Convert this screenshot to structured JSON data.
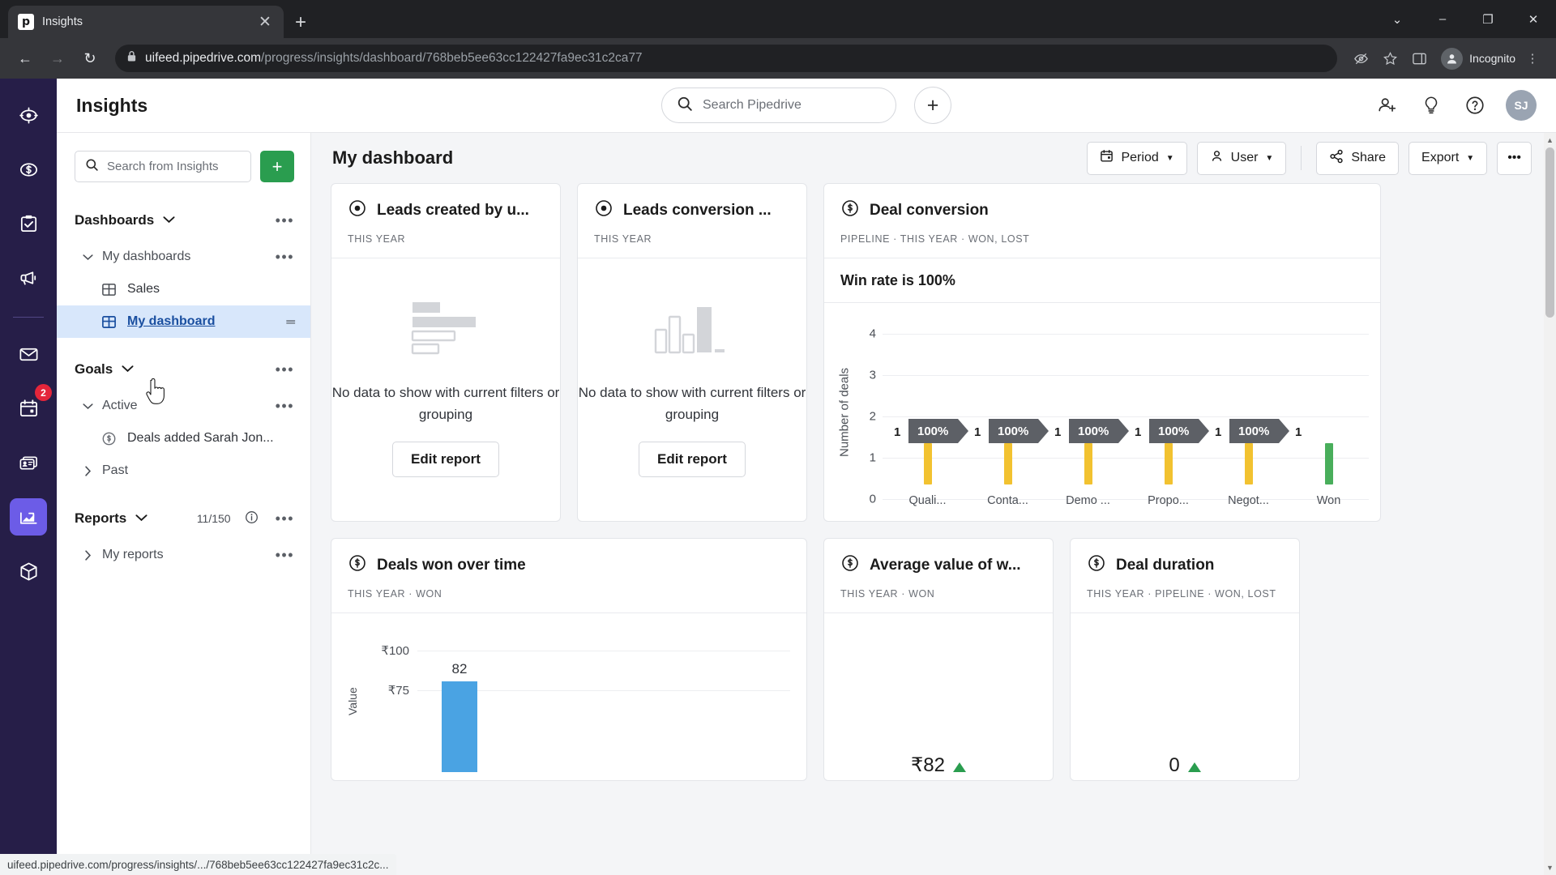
{
  "browser": {
    "tab": {
      "title": "Insights",
      "favicon_letter": "p",
      "close_icon": "close-icon"
    },
    "new_tab_label": "+",
    "window": {
      "minimize": "–",
      "maximize": "❐",
      "close": "✕",
      "chevron_down": "⌄"
    },
    "nav": {
      "back": "←",
      "forward": "→",
      "reload": "↻"
    },
    "url": {
      "lock_icon": "lock-icon",
      "domain": "uifeed.pipedrive.com",
      "path": "/progress/insights/dashboard/768beb5ee63cc122427fa9ec31c2ca77"
    },
    "omni_icons": {
      "block_third_party": "eye-slash-icon",
      "bookmark": "star-icon",
      "side_panel": "side-panel-icon",
      "menu": "kebab-menu-icon"
    },
    "incognito_label": "Incognito",
    "status_bar": "uifeed.pipedrive.com/progress/insights/.../768beb5ee63cc122427fa9ec31c2c..."
  },
  "rail": {
    "items": [
      {
        "name": "leads",
        "icon": "target-icon",
        "active": false,
        "badge": ""
      },
      {
        "name": "deals",
        "icon": "dollar-circle-icon",
        "active": false,
        "badge": ""
      },
      {
        "name": "activities",
        "icon": "clipboard-check-icon",
        "active": false,
        "badge": ""
      },
      {
        "name": "campaigns",
        "icon": "megaphone-icon",
        "active": false,
        "badge": ""
      },
      {
        "name": "mail",
        "icon": "envelope-icon",
        "active": false,
        "badge": ""
      },
      {
        "name": "calendar",
        "icon": "calendar-icon",
        "active": false,
        "badge": "2"
      },
      {
        "name": "contacts",
        "icon": "contact-card-icon",
        "active": false,
        "badge": ""
      },
      {
        "name": "insights",
        "icon": "chart-line-icon",
        "active": true,
        "badge": ""
      },
      {
        "name": "products",
        "icon": "box-icon",
        "active": false,
        "badge": ""
      }
    ],
    "more_label": "•••"
  },
  "appbar": {
    "title": "Insights",
    "search_placeholder": "Search Pipedrive",
    "add_label": "+",
    "icons": [
      {
        "name": "add-user-icon"
      },
      {
        "name": "lightbulb-icon"
      },
      {
        "name": "help-circle-icon"
      }
    ],
    "avatar_initials": "SJ"
  },
  "sidebar": {
    "search_placeholder": "Search from Insights",
    "add_button_label": "+",
    "sections": [
      {
        "title": "Dashboards",
        "caret": "chevron-down-icon",
        "menu": "•••",
        "groups": [
          {
            "label": "My dashboards",
            "caret": "chevron-down-icon",
            "menu": "•••",
            "items": [
              {
                "label": "Sales",
                "icon": "dashboard-grid-icon",
                "selected": false
              },
              {
                "label": "My dashboard",
                "icon": "dashboard-grid-icon",
                "selected": true,
                "grip": "drag-handle-icon"
              }
            ]
          }
        ]
      },
      {
        "title": "Goals",
        "caret": "chevron-down-icon",
        "menu": "•••",
        "groups": [
          {
            "label": "Active",
            "caret": "chevron-down-icon",
            "menu": "•••",
            "items": [
              {
                "label": "Deals added Sarah Jon...",
                "icon": "dollar-circle-icon",
                "selected": false
              }
            ]
          },
          {
            "label": "Past",
            "caret": "chevron-right-icon",
            "menu": "",
            "items": []
          }
        ]
      },
      {
        "title": "Reports",
        "caret": "chevron-down-icon",
        "count": "11/150",
        "info": "info-icon",
        "menu": "•••",
        "groups": [
          {
            "label": "My reports",
            "caret": "chevron-right-icon",
            "menu": "•••",
            "items": []
          }
        ]
      }
    ]
  },
  "dashboard": {
    "title": "My dashboard",
    "toolbar": {
      "period_label": "Period",
      "period_icon": "calendar-icon",
      "user_label": "User",
      "user_icon": "person-icon",
      "share_label": "Share",
      "share_icon": "share-icon",
      "export_label": "Export",
      "more_label": "•••"
    },
    "cards": [
      {
        "id": "leads-created-by-user",
        "title": "Leads created by u...",
        "icon": "target-icon",
        "meta": "THIS YEAR",
        "state": "empty",
        "empty_text": "No data to show with current filters or grouping",
        "edit_label": "Edit report",
        "placeholder_icon": "horizontal-bars-placeholder"
      },
      {
        "id": "leads-conversion",
        "title": "Leads conversion ...",
        "icon": "target-icon",
        "meta": "THIS YEAR",
        "state": "empty",
        "empty_text": "No data to show with current filters or grouping",
        "edit_label": "Edit report",
        "placeholder_icon": "vertical-bars-placeholder"
      },
      {
        "id": "deal-conversion",
        "title": "Deal conversion",
        "icon": "dollar-circle-icon",
        "meta": "PIPELINE · THIS YEAR · WON, LOST",
        "state": "chart",
        "headline": "Win rate is 100%"
      },
      {
        "id": "deals-won-over-time",
        "title": "Deals won over time",
        "icon": "dollar-circle-icon",
        "meta": "THIS YEAR · WON",
        "state": "chart"
      },
      {
        "id": "average-value-of-won",
        "title": "Average value of w...",
        "icon": "dollar-circle-icon",
        "meta": "THIS YEAR · WON",
        "state": "stat",
        "value": "₹82",
        "trend": "up"
      },
      {
        "id": "deal-duration",
        "title": "Deal duration",
        "icon": "dollar-circle-icon",
        "meta": "THIS YEAR · PIPELINE · WON, LOST",
        "state": "stat",
        "value": "0",
        "trend": "up"
      }
    ]
  },
  "chart_data": [
    {
      "type": "bar",
      "id": "deal-conversion-funnel",
      "title": "Deal conversion",
      "subtitle": "Win rate is 100%",
      "ylabel": "Number of deals",
      "xlabel": "",
      "ylim": [
        0,
        4
      ],
      "yticks": [
        0,
        1,
        2,
        3,
        4
      ],
      "grid": true,
      "categories": [
        "Quali...",
        "Conta...",
        "Demo ...",
        "Propo...",
        "Negot...",
        "Won"
      ],
      "values": [
        1,
        1,
        1,
        1,
        1,
        1
      ],
      "bar_labels": [
        "1",
        "1",
        "1",
        "1",
        "1",
        "1"
      ],
      "conversion_labels": [
        "100%",
        "100%",
        "100%",
        "100%",
        "100%"
      ],
      "colors": {
        "stage": "#f2c230",
        "won": "#49ae5b",
        "chevron": "#5d6066"
      },
      "legend": ""
    },
    {
      "type": "bar",
      "id": "deals-won-over-time",
      "title": "Deals won over time",
      "ylabel": "Value",
      "xlabel": "",
      "yticks": [
        "₹100",
        "₹75"
      ],
      "grid": true,
      "categories": [
        ""
      ],
      "values": [
        82
      ],
      "bar_labels": [
        "82"
      ],
      "colors": {
        "bar": "#4aa3e3"
      }
    }
  ]
}
